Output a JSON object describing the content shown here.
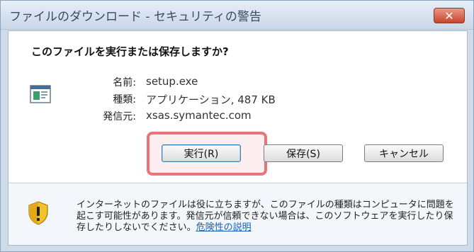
{
  "window": {
    "title": "ファイルのダウンロード - セキュリティの警告",
    "close_glyph": "✕"
  },
  "dialog": {
    "question": "このファイルを実行または保存しますか?",
    "file_info": {
      "name_label": "名前:",
      "name_value": "setup.exe",
      "type_label": "種類:",
      "type_value": "アプリケーション, 487 KB",
      "publisher_label": "発信元:",
      "publisher_value": "xsas.symantec.com"
    },
    "buttons": {
      "run": "実行(R)",
      "save": "保存(S)",
      "cancel": "キャンセル"
    },
    "warning": {
      "text": "インターネットのファイルは役に立ちますが、このファイルの種類はコンピュータに問題を起こす可能性があります。発信元が信頼できない場合は、このソフトウェアを実行したり保存したりしないでください。",
      "link": "危険性の説明"
    }
  },
  "colors": {
    "highlight": "#e8747a",
    "link": "#1a5fb4",
    "close_button": "#c8452b"
  },
  "icons": {
    "file": "application-file-icon",
    "shield": "security-shield-warning-icon",
    "close": "close-icon"
  }
}
